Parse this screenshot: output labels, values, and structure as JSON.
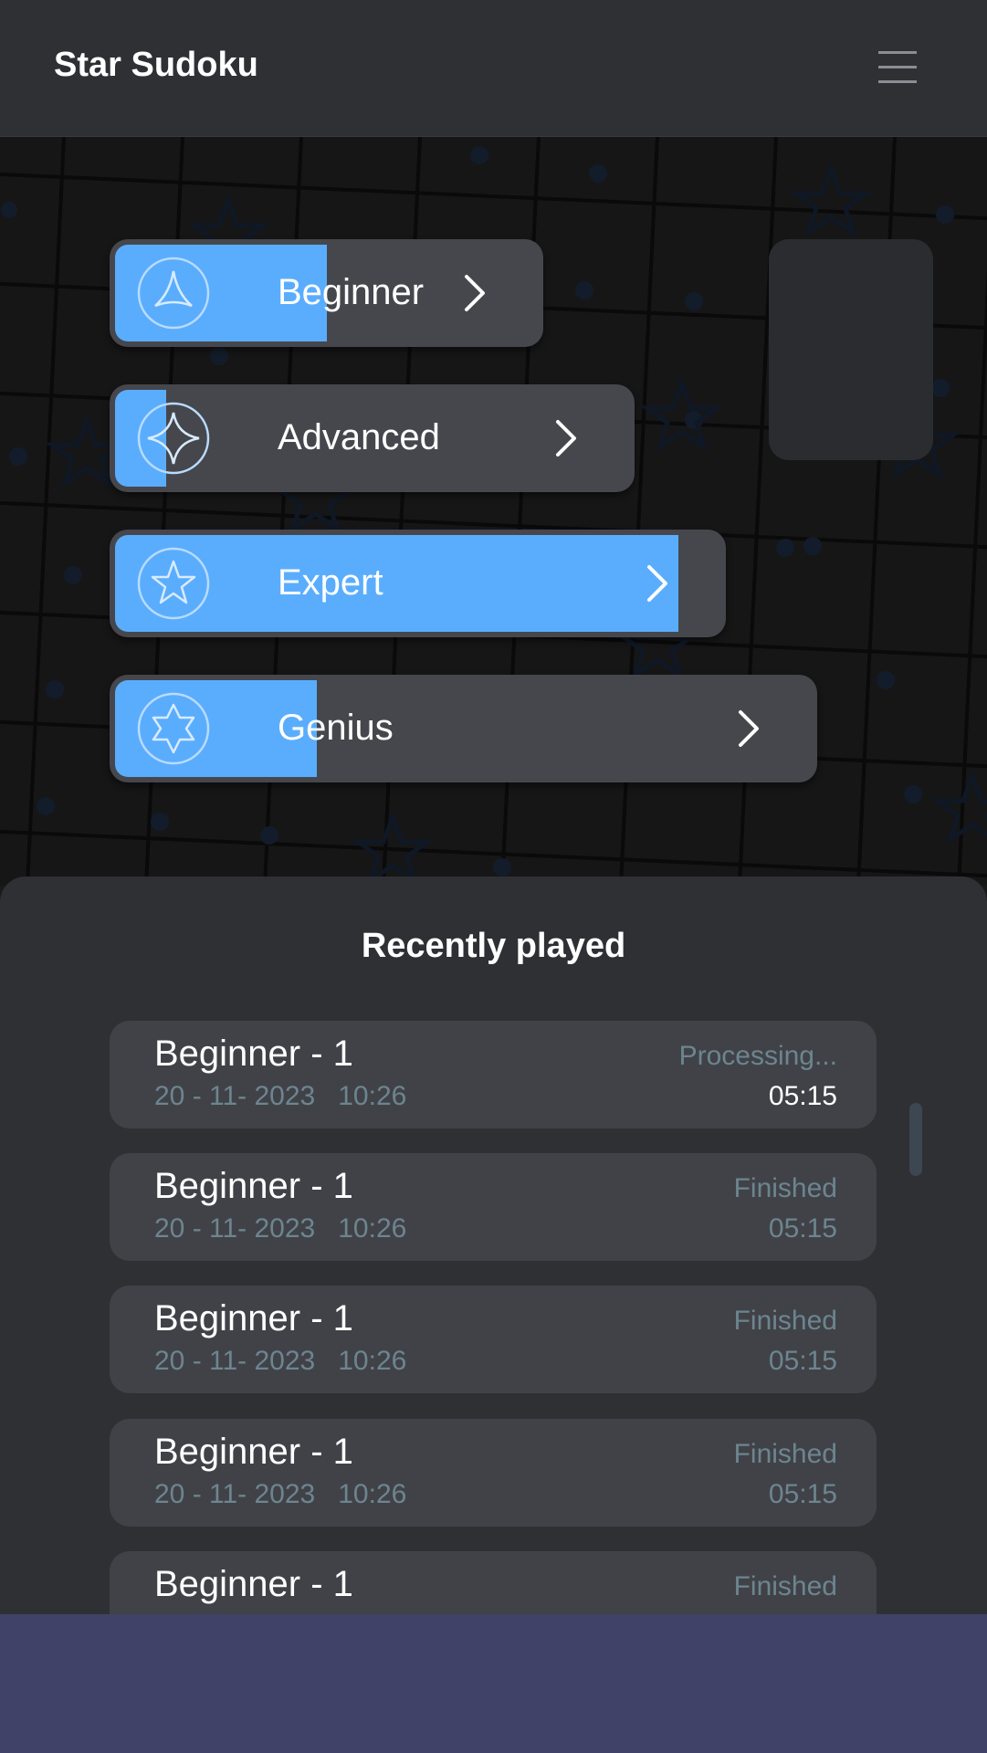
{
  "app": {
    "title": "Star Sudoku"
  },
  "header": {
    "menu_icon": "hamburger-menu-icon"
  },
  "levels": [
    {
      "label": "Beginner",
      "icon": "triangle-star-icon",
      "progress": 0.5
    },
    {
      "label": "Advanced",
      "icon": "four-point-star-icon",
      "progress": 0.1
    },
    {
      "label": "Expert",
      "icon": "five-point-star-icon",
      "progress": 0.93
    },
    {
      "label": "Genius",
      "icon": "six-point-star-icon",
      "progress": 0.29
    }
  ],
  "recent": {
    "title": "Recently played",
    "games": [
      {
        "name": "Beginner - 1",
        "date": "20 - 11- 2023   10:26",
        "status": "Processing...",
        "time": "05:15"
      },
      {
        "name": "Beginner - 1",
        "date": "20 - 11- 2023   10:26",
        "status": "Finished",
        "time": "05:15"
      },
      {
        "name": "Beginner - 1",
        "date": "20 - 11- 2023   10:26",
        "status": "Finished",
        "time": "05:15"
      },
      {
        "name": "Beginner - 1",
        "date": "20 - 11- 2023   10:26",
        "status": "Finished",
        "time": "05:15"
      },
      {
        "name": "Beginner - 1",
        "date": "",
        "status": "Finished",
        "time": ""
      }
    ]
  },
  "colors": {
    "accent": "#5aadfd",
    "header": "#2f3034",
    "card": "#46474c",
    "bottom_bar": "#404267"
  }
}
